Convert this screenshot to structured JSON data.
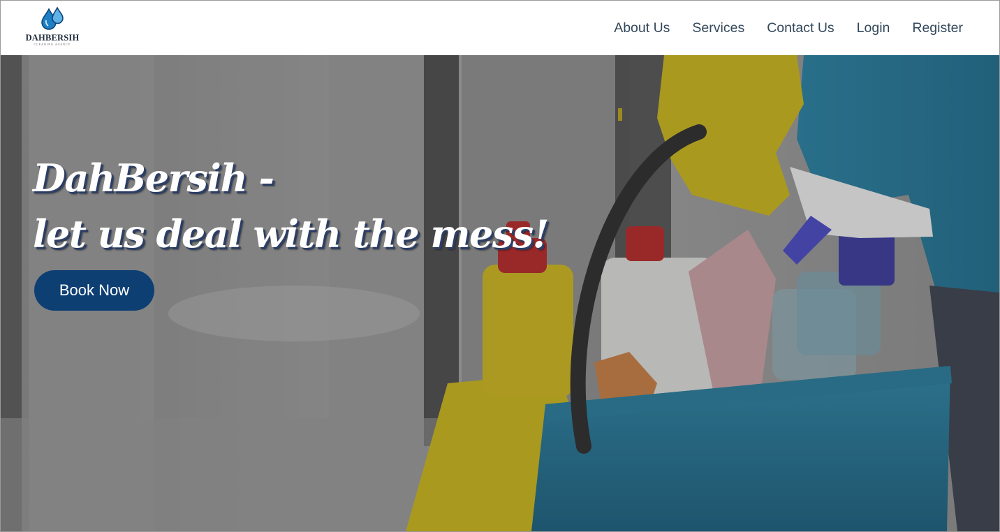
{
  "header": {
    "logo_name": "DAHBERSIH",
    "logo_tagline": "CLEANING AGENCY",
    "nav": [
      {
        "label": "About Us"
      },
      {
        "label": "Services"
      },
      {
        "label": "Contact Us"
      },
      {
        "label": "Login"
      },
      {
        "label": "Register"
      }
    ]
  },
  "hero": {
    "title_line1": "DahBersih -",
    "title_line2": "let us deal with the mess!",
    "cta_label": "Book Now"
  },
  "colors": {
    "nav_text": "#33475b",
    "button_bg": "#0d3f73",
    "logo_drop": "#1f7fc4"
  },
  "icons": {
    "logo": "water-drops-icon"
  }
}
